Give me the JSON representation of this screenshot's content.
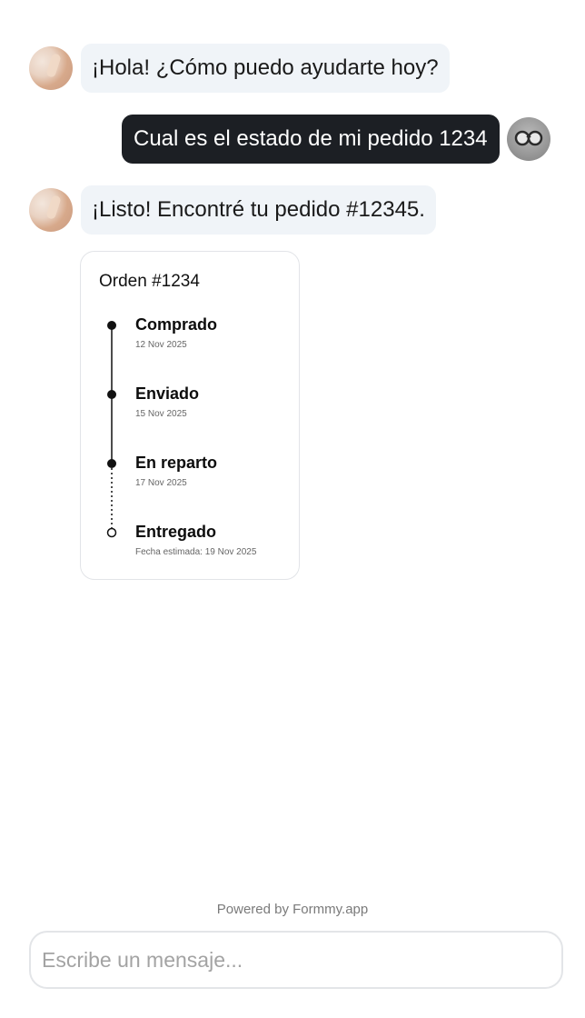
{
  "messages": [
    {
      "role": "bot",
      "text": "¡Hola! ¿Cómo puedo ayudarte hoy?"
    },
    {
      "role": "user",
      "text": "Cual es el estado de mi pedido 1234"
    },
    {
      "role": "bot",
      "text": "¡Listo! Encontré tu pedido #12345."
    }
  ],
  "order_card": {
    "title": "Orden #1234",
    "steps": [
      {
        "label": "Comprado",
        "date": "12 Nov 2025",
        "done": true
      },
      {
        "label": "Enviado",
        "date": "15 Nov 2025",
        "done": true
      },
      {
        "label": "En reparto",
        "date": "17 Nov 2025",
        "done": true
      },
      {
        "label": "Entregado",
        "date": "Fecha estimada: 19 Nov 2025",
        "done": false
      }
    ]
  },
  "footer": {
    "powered_by": "Powered by Formmy.app"
  },
  "composer": {
    "placeholder": "Escribe un mensaje..."
  },
  "icons": {
    "bot_avatar": "bot-avatar-icon",
    "user_avatar": "user-avatar-icon"
  },
  "colors": {
    "bot_bubble": "#f0f4f8",
    "user_bubble": "#1c1f24",
    "timeline": "#111111"
  }
}
